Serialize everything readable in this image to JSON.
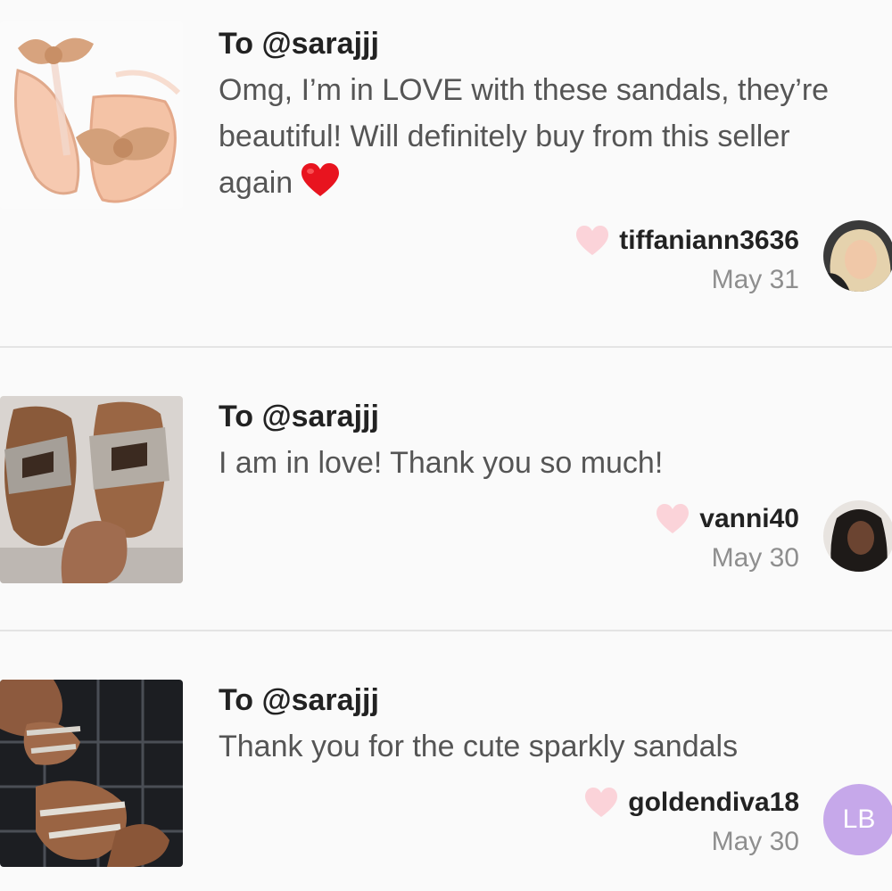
{
  "colors": {
    "background": "#fafafa",
    "divider": "#e4e4e4",
    "like_heart": "#fbd3d9",
    "emoji_heart": "#e8141f",
    "avatar_initials_bg": "#c6a8ea",
    "date_text": "#8e8e8e"
  },
  "reviews": [
    {
      "recipient": "To @sarajjj",
      "message": "Omg, I’m in LOVE with these sandals, they’re beautiful! Will definitely buy from this seller again",
      "emoji": "red-heart-emoji",
      "username": "tiffaniann3636",
      "date": "May 31",
      "photo": "rose-gold-bow-jelly-sandals",
      "avatar": "user-photo-avatar"
    },
    {
      "recipient": "To @sarajjj",
      "message": "I am in love! Thank you so much!",
      "username": "vanni40",
      "date": "May 30",
      "photo": "rhinestone-h-slide-sandals",
      "avatar": "user-photo-avatar"
    },
    {
      "recipient": "To @sarajjj",
      "message": "Thank you for the cute sparkly sandals",
      "username": "goldendiva18",
      "date": "May 30",
      "photo": "sparkly-strap-sandals",
      "avatar_initials": "LB"
    }
  ]
}
